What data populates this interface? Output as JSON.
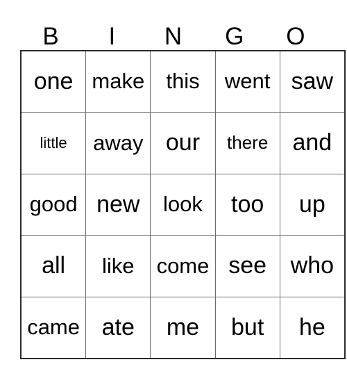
{
  "card": {
    "title": "BINGO",
    "header_letters": [
      "B",
      "I",
      "N",
      "G",
      "O"
    ],
    "rows": 5,
    "columns": 5,
    "background_color": "#ffffff",
    "text_color": "#000000",
    "outer_border_color": "#2b2b2b",
    "inner_border_color": "#6b6b6b",
    "grid": [
      [
        "one",
        "make",
        "this",
        "went",
        "saw"
      ],
      [
        "little",
        "away",
        "our",
        "there",
        "and"
      ],
      [
        "good",
        "new",
        "look",
        "too",
        "up"
      ],
      [
        "all",
        "like",
        "come",
        "see",
        "who"
      ],
      [
        "came",
        "ate",
        "me",
        "but",
        "he"
      ]
    ]
  }
}
